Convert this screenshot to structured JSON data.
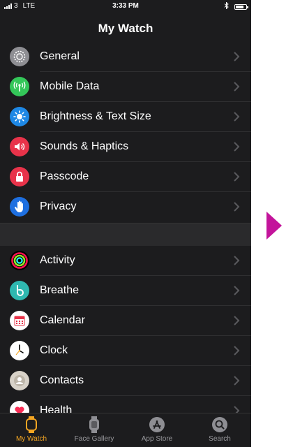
{
  "status_bar": {
    "carrier": "3",
    "network": "LTE",
    "time": "3:33 PM",
    "battery_level": 0.8
  },
  "header": {
    "title": "My Watch"
  },
  "settings_items": [
    {
      "label": "General",
      "icon": "gear-icon",
      "color": "#8e8e93"
    },
    {
      "label": "Mobile Data",
      "icon": "antenna-icon",
      "color": "#34c759"
    },
    {
      "label": "Brightness & Text Size",
      "icon": "sun-icon",
      "color": "#1e88e5"
    },
    {
      "label": "Sounds & Haptics",
      "icon": "speaker-icon",
      "color": "#e8334a"
    },
    {
      "label": "Passcode",
      "icon": "lock-icon",
      "color": "#e8334a"
    },
    {
      "label": "Privacy",
      "icon": "hand-icon",
      "color": "#1e6fe0"
    }
  ],
  "app_items": [
    {
      "label": "Activity",
      "icon": "activity-rings-icon"
    },
    {
      "label": "Breathe",
      "icon": "breathe-icon",
      "color": "#2fb8b0"
    },
    {
      "label": "Calendar",
      "icon": "calendar-icon"
    },
    {
      "label": "Clock",
      "icon": "clock-icon"
    },
    {
      "label": "Contacts",
      "icon": "contacts-icon"
    },
    {
      "label": "Health",
      "icon": "heart-icon"
    }
  ],
  "tab_bar": [
    {
      "label": "My Watch",
      "icon": "watch-icon",
      "active": true
    },
    {
      "label": "Face Gallery",
      "icon": "face-gallery-icon",
      "active": false
    },
    {
      "label": "App Store",
      "icon": "app-store-icon",
      "active": false
    },
    {
      "label": "Search",
      "icon": "search-icon",
      "active": false
    }
  ],
  "colors": {
    "accent": "#f4a623",
    "background": "#1c1c1e",
    "arrow": "#c3149b"
  }
}
